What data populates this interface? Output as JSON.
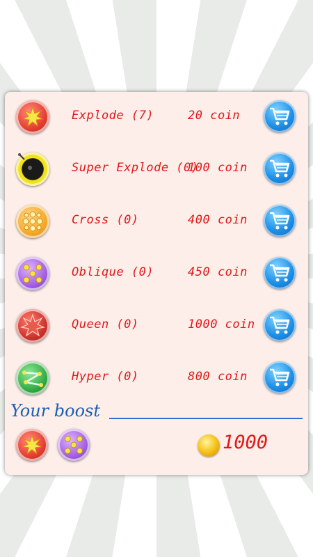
{
  "shop": {
    "items": [
      {
        "name": "Explode (7)",
        "price": "20 coin",
        "icon": "explode-icon",
        "color": "#e23a2e"
      },
      {
        "name": "Super Explode (0)",
        "price": "100 coin",
        "icon": "bomb-icon",
        "color": "#f2e21a"
      },
      {
        "name": "Cross (0)",
        "price": "400 coin",
        "icon": "cross-icon",
        "color": "#f5a623"
      },
      {
        "name": "Oblique (0)",
        "price": "450 coin",
        "icon": "oblique-icon",
        "color": "#a05be0"
      },
      {
        "name": "Queen (0)",
        "price": "1000 coin",
        "icon": "queen-icon",
        "color": "#c8302a"
      },
      {
        "name": "Hyper (0)",
        "price": "800 coin",
        "icon": "hyper-icon",
        "color": "#2fa840"
      }
    ],
    "cart_icon": "shopping-cart-icon"
  },
  "boost": {
    "title": "Your boost",
    "owned": [
      "explode-icon",
      "oblique-icon"
    ]
  },
  "wallet": {
    "coins": "1000",
    "icon": "gold-coin-icon"
  }
}
